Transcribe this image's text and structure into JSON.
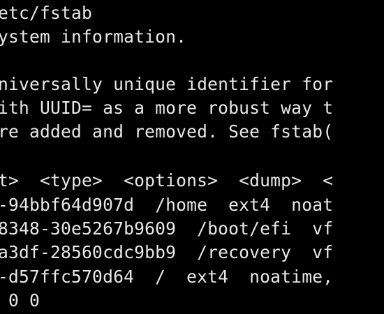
{
  "terminal": {
    "background": "#000000",
    "foreground": "#e8e8e8",
    "lines": [
      "etc/fstab",
      "ystem information.",
      "",
      "niversally unique identifier for",
      "ith UUID= as a more robust way t",
      "re added and removed. See fstab(",
      "",
      "t>  <type>  <options>  <dump>  <",
      "-94bbf64d907d  /home  ext4  noat",
      "8348-30e5267b9609  /boot/efi  vf",
      "a3df-28560cdc9bb9  /recovery  vf",
      "-d57ffc570d64  /  ext4  noatime,",
      " 0 0"
    ]
  }
}
